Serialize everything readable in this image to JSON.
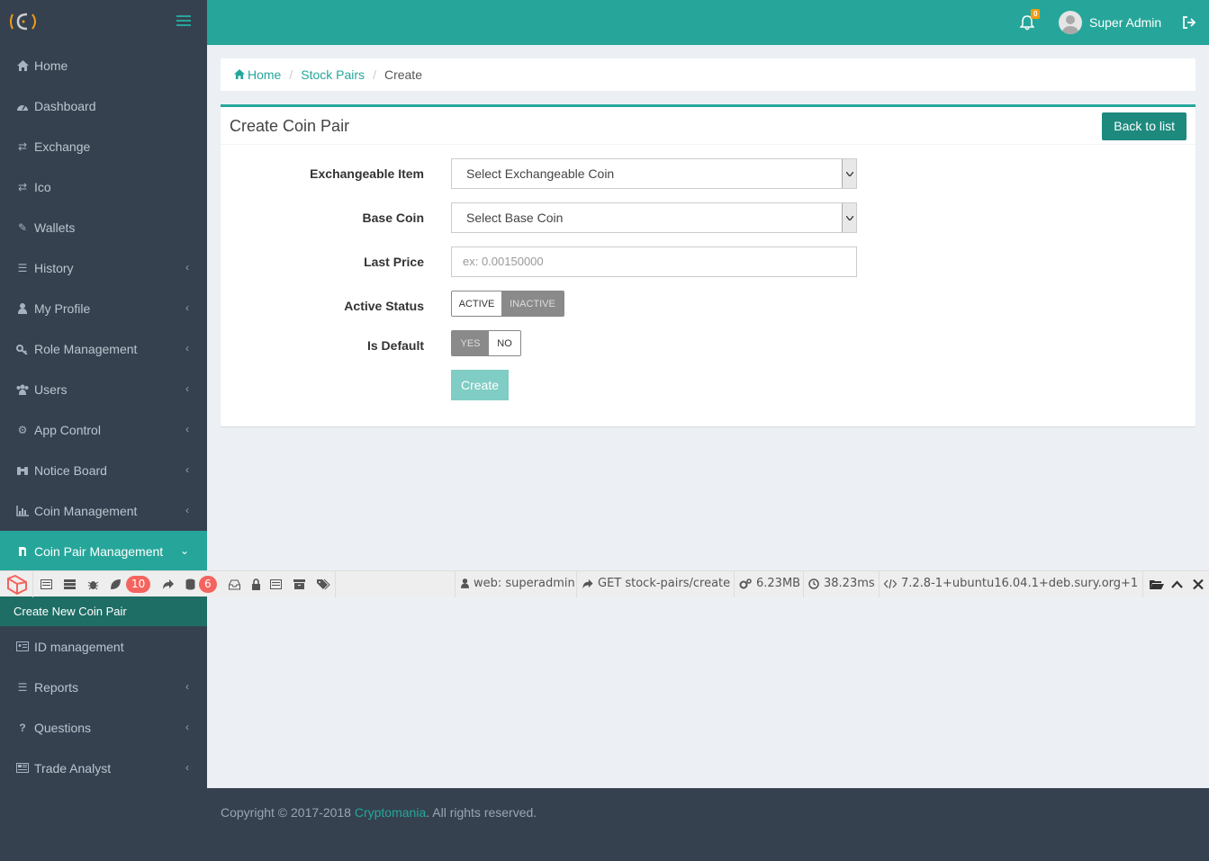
{
  "sidebar": {
    "items": [
      {
        "label": "Home",
        "icon": "home-icon",
        "has_chevron": false
      },
      {
        "label": "Dashboard",
        "icon": "dashboard-icon",
        "has_chevron": false
      },
      {
        "label": "Exchange",
        "icon": "exchange-icon",
        "has_chevron": false
      },
      {
        "label": "Ico",
        "icon": "exchange-icon",
        "has_chevron": false
      },
      {
        "label": "Wallets",
        "icon": "pen-icon",
        "has_chevron": false
      },
      {
        "label": "History",
        "icon": "list-icon",
        "has_chevron": true
      },
      {
        "label": "My Profile",
        "icon": "user-icon",
        "has_chevron": true
      },
      {
        "label": "Role Management",
        "icon": "key-icon",
        "has_chevron": true
      },
      {
        "label": "Users",
        "icon": "users-icon",
        "has_chevron": true
      },
      {
        "label": "App Control",
        "icon": "gear-icon",
        "has_chevron": true
      },
      {
        "label": "Notice Board",
        "icon": "binoculars-icon",
        "has_chevron": true
      },
      {
        "label": "Coin Management",
        "icon": "bar-chart-icon",
        "has_chevron": true
      },
      {
        "label": "Coin Pair Management",
        "icon": "coin-pair-icon",
        "has_chevron": true
      },
      {
        "label": "ID management",
        "icon": "id-card-icon",
        "has_chevron": false
      },
      {
        "label": "Reports",
        "icon": "list-icon",
        "has_chevron": true
      },
      {
        "label": "Questions",
        "icon": "question-icon",
        "has_chevron": true
      },
      {
        "label": "Trade Analyst",
        "icon": "newspaper-icon",
        "has_chevron": true
      }
    ],
    "submenu": {
      "label": "Create New Coin Pair"
    }
  },
  "header": {
    "notification_count": "0",
    "user_name": "Super Admin"
  },
  "breadcrumb": {
    "home": "Home",
    "stock_pairs": "Stock Pairs",
    "current": "Create"
  },
  "form": {
    "title": "Create Coin Pair",
    "back_label": "Back to list",
    "exchangeable_label": "Exchangeable Item",
    "exchangeable_value": "Select Exchangeable Coin",
    "base_coin_label": "Base Coin",
    "base_coin_value": "Select Base Coin",
    "last_price_label": "Last Price",
    "last_price_placeholder": "ex: 0.00150000",
    "active_status_label": "Active Status",
    "active_on": "ACTIVE",
    "active_off": "INACTIVE",
    "is_default_label": "Is Default",
    "default_yes": "YES",
    "default_no": "NO",
    "create_label": "Create"
  },
  "debugbar": {
    "messages_count": "10",
    "queries_count": "6",
    "auth": "web: superadmin",
    "route": "GET stock-pairs/create",
    "memory": "6.23MB",
    "time": "38.23ms",
    "php_version": "7.2.8-1+ubuntu16.04.1+deb.sury.org+1"
  },
  "footer": {
    "prefix": "Copyright © 2017-2018 ",
    "brand": "Cryptomania",
    "suffix": ". All rights reserved."
  },
  "colors": {
    "accent": "#26a69a",
    "sidebar_bg": "#364150",
    "page_bg": "#ecf0f5"
  }
}
